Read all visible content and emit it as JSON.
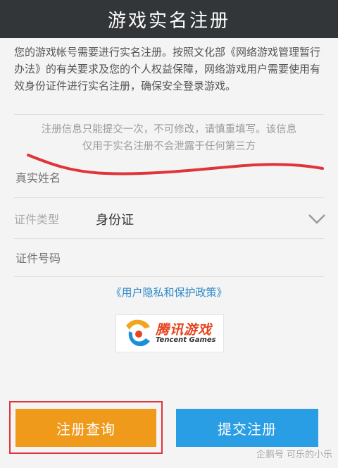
{
  "header": {
    "title": "游戏实名注册"
  },
  "intro": {
    "text": "您的游戏帐号需要进行实名注册。按照文化部《网络游戏管理暂行办法》的有关要求及您的个人权益保障，网络游戏用户需要使用有效身份证件进行实名注册，确保安全登录游戏。"
  },
  "notice": {
    "line1": "注册信息只能提交一次，不可修改，请慎重填写。该信息",
    "line2": "仅用于实名注册不会泄露于任何第三方"
  },
  "form": {
    "name_placeholder": "真实姓名",
    "id_type_label": "证件类型",
    "id_type_value": "身份证",
    "id_number_placeholder": "证件号码"
  },
  "policy_link": "《用户隐私和保护政策》",
  "logo": {
    "name": "腾讯游戏",
    "sub": "Tencent Games"
  },
  "buttons": {
    "query": "注册查询",
    "submit": "提交注册"
  },
  "watermark": "企鹅号 可乐的小乐",
  "colors": {
    "header_bg": "#333638",
    "query_button": "#f09a1c",
    "submit_button": "#2a9ee4",
    "link": "#2b87c8",
    "annotation_red": "#e0343a"
  }
}
